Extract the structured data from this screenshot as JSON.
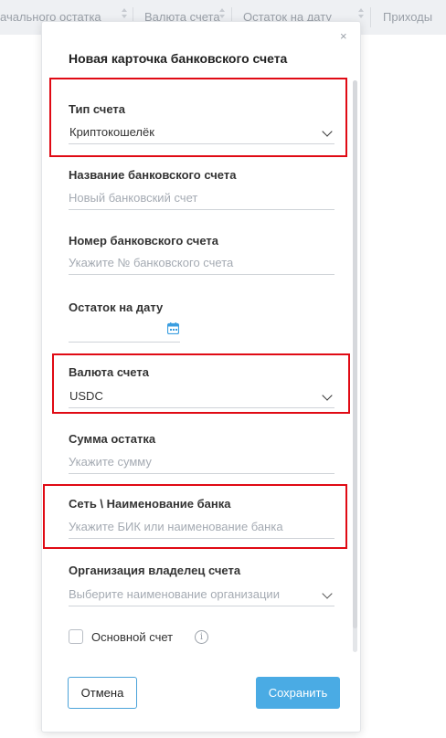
{
  "background_table": {
    "columns": [
      "ачального остатка",
      "Валюта счета",
      "Остаток на дату",
      "Приходы"
    ]
  },
  "modal": {
    "title": "Новая карточка банковского счета",
    "close_icon": "×",
    "fields": {
      "account_type": {
        "label": "Тип счета",
        "value": "Криптокошелёк"
      },
      "account_name": {
        "label": "Название банковского счета",
        "placeholder": "Новый банковский счет"
      },
      "account_number": {
        "label": "Номер банковского счета",
        "placeholder": "Укажите № банковского счета"
      },
      "balance_date": {
        "label": "Остаток на дату",
        "value": ""
      },
      "currency": {
        "label": "Валюта счета",
        "value": "USDC"
      },
      "balance_amount": {
        "label": "Сумма остатка",
        "placeholder": "Укажите сумму"
      },
      "network_bank": {
        "label": "Сеть \\ Наименование банка",
        "placeholder": "Укажите БИК или наименование банка"
      },
      "owner_org": {
        "label": "Организация владелец счета",
        "placeholder": "Выберите наименование организации"
      }
    },
    "main_account": {
      "label": "Основной счет",
      "checked": false,
      "info_icon": "i"
    },
    "buttons": {
      "cancel": "Отмена",
      "save": "Сохранить"
    }
  },
  "colors": {
    "accent": "#4aabe4",
    "highlight": "#e00a14"
  }
}
